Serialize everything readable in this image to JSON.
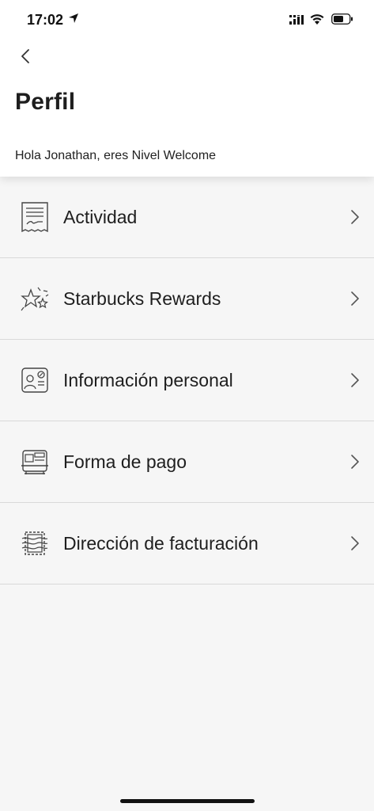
{
  "status_bar": {
    "time": "17:02"
  },
  "header": {
    "title": "Perfil",
    "greeting": "Hola Jonathan, eres Nivel Welcome"
  },
  "menu": {
    "items": [
      {
        "label": "Actividad",
        "icon": "receipt-icon"
      },
      {
        "label": "Starbucks Rewards",
        "icon": "sparkles-icon"
      },
      {
        "label": "Información personal",
        "icon": "id-card-icon"
      },
      {
        "label": "Forma de pago",
        "icon": "payment-terminal-icon"
      },
      {
        "label": "Dirección de facturación",
        "icon": "stamp-envelope-icon"
      }
    ]
  },
  "colors": {
    "background": "#f6f6f6",
    "header_bg": "#ffffff",
    "text": "#1e1e1e",
    "divider": "#d9d9d9"
  }
}
